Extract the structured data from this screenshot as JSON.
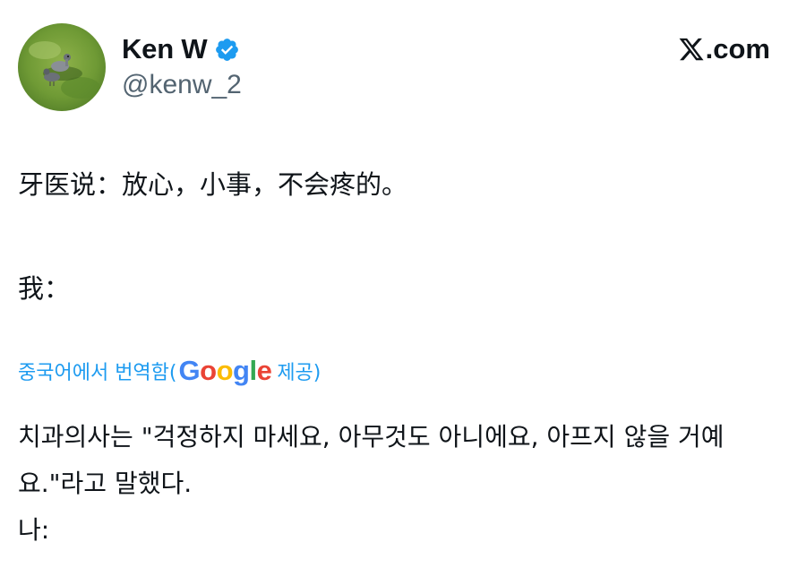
{
  "author": {
    "display_name": "Ken W",
    "handle": "@kenw_2",
    "verified": true,
    "verified_color": "#1d9bf0"
  },
  "brand": {
    "logo_icon": "x-logo-icon",
    "text": ".com"
  },
  "post": {
    "original_line1": "牙医说：放心，小事，不会疼的。",
    "original_line2": "我："
  },
  "translation": {
    "credit_prefix": "중국어에서 번역함(",
    "provider": "Google",
    "credit_suffix": "제공)",
    "text_line1": "치과의사는 \"걱정하지 마세요, 아무것도 아니에요, 아프지 않을 거예요.\"라고 말했다.",
    "text_line2": "나:"
  },
  "colors": {
    "text": "#0f1419",
    "secondary": "#536471",
    "link": "#1d9bf0"
  }
}
